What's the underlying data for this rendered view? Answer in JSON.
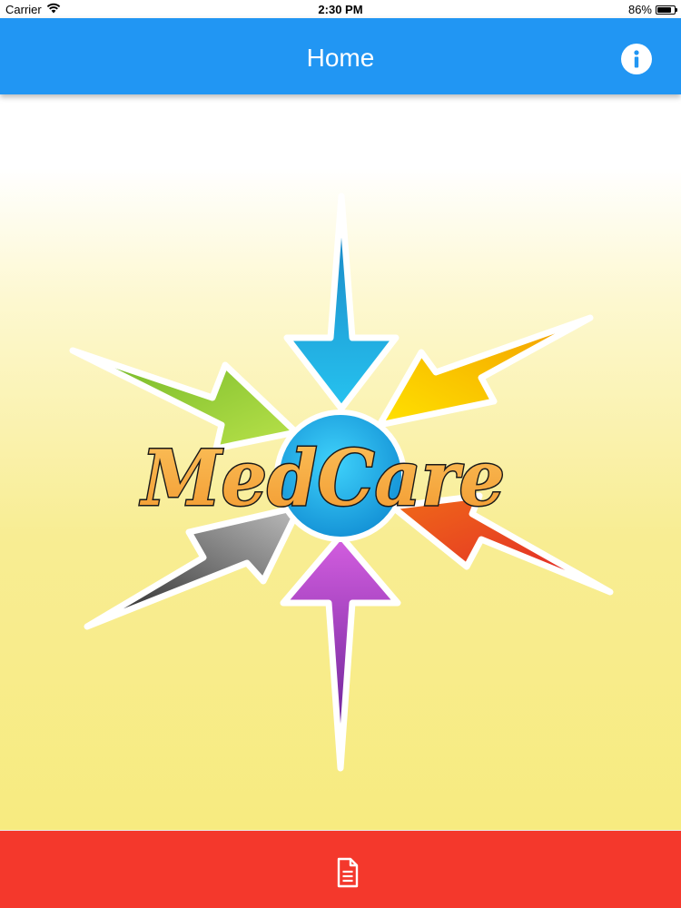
{
  "status_bar": {
    "carrier": "Carrier",
    "time": "2:30 PM",
    "battery_percent_label": "86%",
    "battery_level": 0.86
  },
  "app_bar": {
    "title": "Home",
    "info_icon": "info-circle-icon",
    "color": "#2196f3"
  },
  "logo": {
    "text": "MedCare",
    "arrow_colors": [
      "#1fa9e6",
      "#f5c400",
      "#e8321e",
      "#9b35b8",
      "#444444",
      "#8cc63f"
    ]
  },
  "bottom_bar": {
    "icon": "document-icon",
    "color": "#f4382c"
  }
}
